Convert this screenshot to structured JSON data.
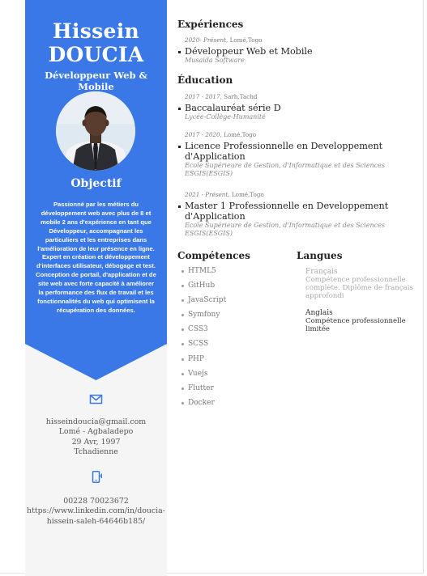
{
  "profile": {
    "name_line1": "Hissein",
    "name_line2": "DOUCIA",
    "role": "Développeur Web & Mobile"
  },
  "objective": {
    "title": "Objectif",
    "text": "Passionné par les métiers du développement web avec plus de 8 et mobile 2 ans d'expérience en tant que Développeur, accompagnant les particuliers et les entreprises dans l'amélioration de leur présence en ligne. Expert en création et développement d'interfaces utilisateur, débogage et test. Conception de portail, d'application et de site web avec forte capacité à améliorer la performance des flux de travail et les fonctionnalités du web qui optimisent la récupération des données."
  },
  "contact": {
    "email": "hisseindoucia@gmail.com",
    "address": "Lomé - Agbaladepo",
    "birthdate": "29 Avr, 1997",
    "nationality": "Tchadienne",
    "phone": "00228 70023672",
    "linkedin_line1": "https://www.linkedin.com/in/doucia-",
    "linkedin_line2": "hissein-saleh-64646b185/"
  },
  "experiences": {
    "title": "Expériences",
    "items": [
      {
        "date_range": "2020- Présent",
        "location": ", Lomé,Togo",
        "role": "Développeur Web et Mobile",
        "company": "Musaida Software"
      }
    ]
  },
  "education": {
    "title": "Éducation",
    "items": [
      {
        "date_range": "2017 - 2017",
        "location": ", Sarh,Tachd",
        "degree": "Baccalauréat série D",
        "school": "Lycée-Collège-Humanité"
      },
      {
        "date_range": "2017 - 2020",
        "location": ", Lomé,Togo",
        "degree": "Licence Professionnelle en Developpement d'Application",
        "school": "Ecole Supérieure de Gestion, d'Informatique et des Sciences ESGIS(ESGIS)"
      },
      {
        "date_range": "2021 - Présent",
        "location": ", Lomé,Togo",
        "degree": "Master 1 Professionnelle en Developpement d'Application",
        "school": "Ecole Supérieure de Gestion, d'Informatique et des Sciences ESGIS(ESGIS)"
      }
    ]
  },
  "skills": {
    "title": "Compétences",
    "items": [
      "HTML5",
      "GitHub",
      "JavaScript",
      "Symfony",
      "CSS3",
      "SCSS",
      "PHP",
      "Vuejs",
      "Flutter",
      "Docker"
    ]
  },
  "languages": {
    "title": "Langues",
    "items": [
      {
        "name": "Français",
        "level": "Compétence professionnelle complète. Diplôme de français approfondi"
      },
      {
        "name": "Anglais",
        "level": "Compétence professionnelle limitée"
      }
    ]
  },
  "icons": {
    "email": "envelope-icon",
    "phone": "phone-icon"
  },
  "colors": {
    "accent": "#3b78e7",
    "sidebar_bg": "#f5f5f5"
  }
}
